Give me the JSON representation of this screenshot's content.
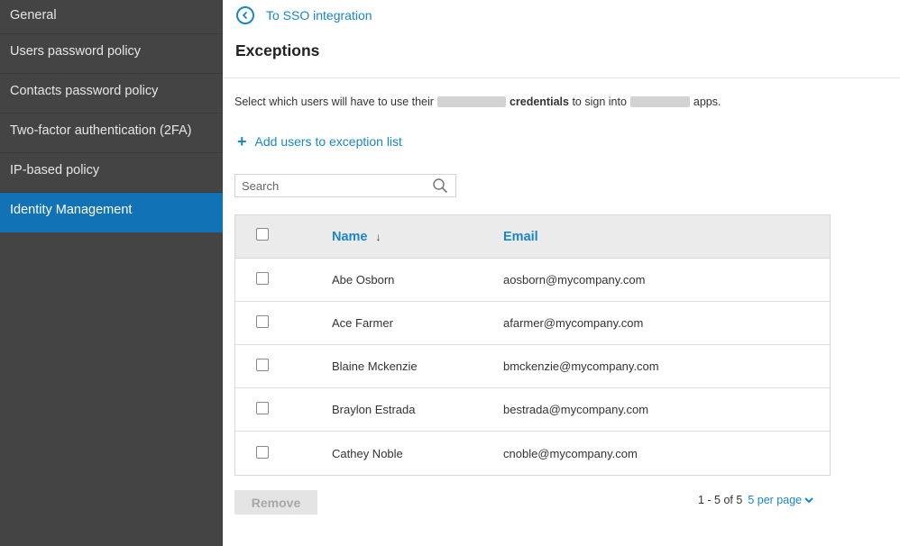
{
  "sidebar": {
    "items": [
      {
        "label": "General",
        "active": false
      },
      {
        "label": "Users password policy",
        "active": false
      },
      {
        "label": "Contacts password policy",
        "active": false
      },
      {
        "label": "Two-factor authentication (2FA)",
        "active": false
      },
      {
        "label": "IP-based policy",
        "active": false
      },
      {
        "label": "Identity Management",
        "active": true
      }
    ]
  },
  "header": {
    "back_label": "To SSO integration",
    "title": "Exceptions"
  },
  "description": {
    "part1": "Select which users will have to use their",
    "bold": "credentials",
    "part2": "to sign into",
    "part3": "apps."
  },
  "add_users_label": "Add users to exception list",
  "search": {
    "placeholder": "Search",
    "value": ""
  },
  "table": {
    "columns": {
      "name": "Name",
      "email": "Email"
    },
    "sort_indicator": "↓",
    "rows": [
      {
        "name": "Abe Osborn",
        "email": "aosborn@mycompany.com"
      },
      {
        "name": "Ace Farmer",
        "email": "afarmer@mycompany.com"
      },
      {
        "name": "Blaine Mckenzie",
        "email": "bmckenzie@mycompany.com"
      },
      {
        "name": "Braylon Estrada",
        "email": "bestrada@mycompany.com"
      },
      {
        "name": "Cathey Noble",
        "email": "cnoble@mycompany.com"
      }
    ]
  },
  "footer": {
    "remove_label": "Remove",
    "range_text": "1 - 5 of 5",
    "per_page_label": "5 per page"
  },
  "colors": {
    "accent": "#1a86c8",
    "sidebar_bg": "#444444",
    "sidebar_active": "#1173b5"
  }
}
